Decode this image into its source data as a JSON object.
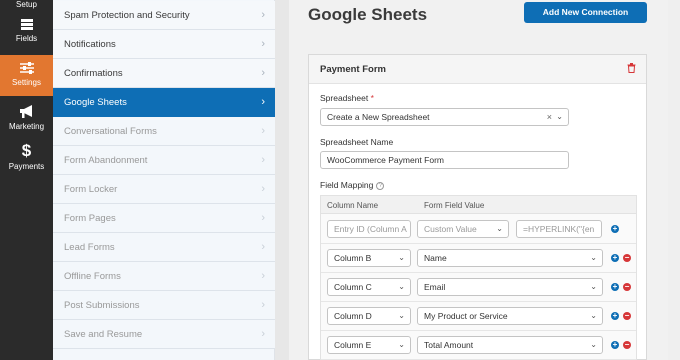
{
  "leftnav": {
    "items": [
      {
        "label": "Setup",
        "icon": "gear-icon"
      },
      {
        "label": "Fields",
        "icon": "fields-icon"
      },
      {
        "label": "Settings",
        "icon": "sliders-icon"
      },
      {
        "label": "Marketing",
        "icon": "megaphone-icon"
      },
      {
        "label": "Payments",
        "icon": "dollar-icon"
      }
    ],
    "active_color": "#e27730"
  },
  "submenu": {
    "items": [
      {
        "label": "Spam Protection and Security",
        "state": "enabled"
      },
      {
        "label": "Notifications",
        "state": "enabled"
      },
      {
        "label": "Confirmations",
        "state": "enabled"
      },
      {
        "label": "Google Sheets",
        "state": "active"
      },
      {
        "label": "Conversational Forms",
        "state": "disabled"
      },
      {
        "label": "Form Abandonment",
        "state": "disabled"
      },
      {
        "label": "Form Locker",
        "state": "disabled"
      },
      {
        "label": "Form Pages",
        "state": "disabled"
      },
      {
        "label": "Lead Forms",
        "state": "disabled"
      },
      {
        "label": "Offline Forms",
        "state": "disabled"
      },
      {
        "label": "Post Submissions",
        "state": "disabled"
      },
      {
        "label": "Save and Resume",
        "state": "disabled"
      }
    ],
    "chevron": "›"
  },
  "main": {
    "title": "Google Sheets",
    "add_button": "Add New Connection",
    "card": {
      "title": "Payment Form",
      "spreadsheet_label": "Spreadsheet",
      "required_mark": "*",
      "spreadsheet_value": "Create a New Spreadsheet",
      "spreadsheet_name_label": "Spreadsheet Name",
      "spreadsheet_name_value": "WooCommerce Payment Form",
      "field_mapping_label": "Field Mapping",
      "help_mark": "?",
      "mapping": {
        "col_header": "Column Name",
        "val_header": "Form Field Value",
        "first_row": {
          "column_placeholder": "Entry ID (Column A",
          "value_placeholder": "Custom Value",
          "formula": "=HYPERLINK(\"{en"
        },
        "rows": [
          {
            "column": "Column B",
            "value": "Name"
          },
          {
            "column": "Column C",
            "value": "Email"
          },
          {
            "column": "Column D",
            "value": "My Product or Service"
          },
          {
            "column": "Column E",
            "value": "Total Amount"
          }
        ]
      }
    }
  },
  "colors": {
    "primary": "#0e6eb5",
    "danger": "#d63638",
    "nav_bg": "#2b2b2b"
  }
}
